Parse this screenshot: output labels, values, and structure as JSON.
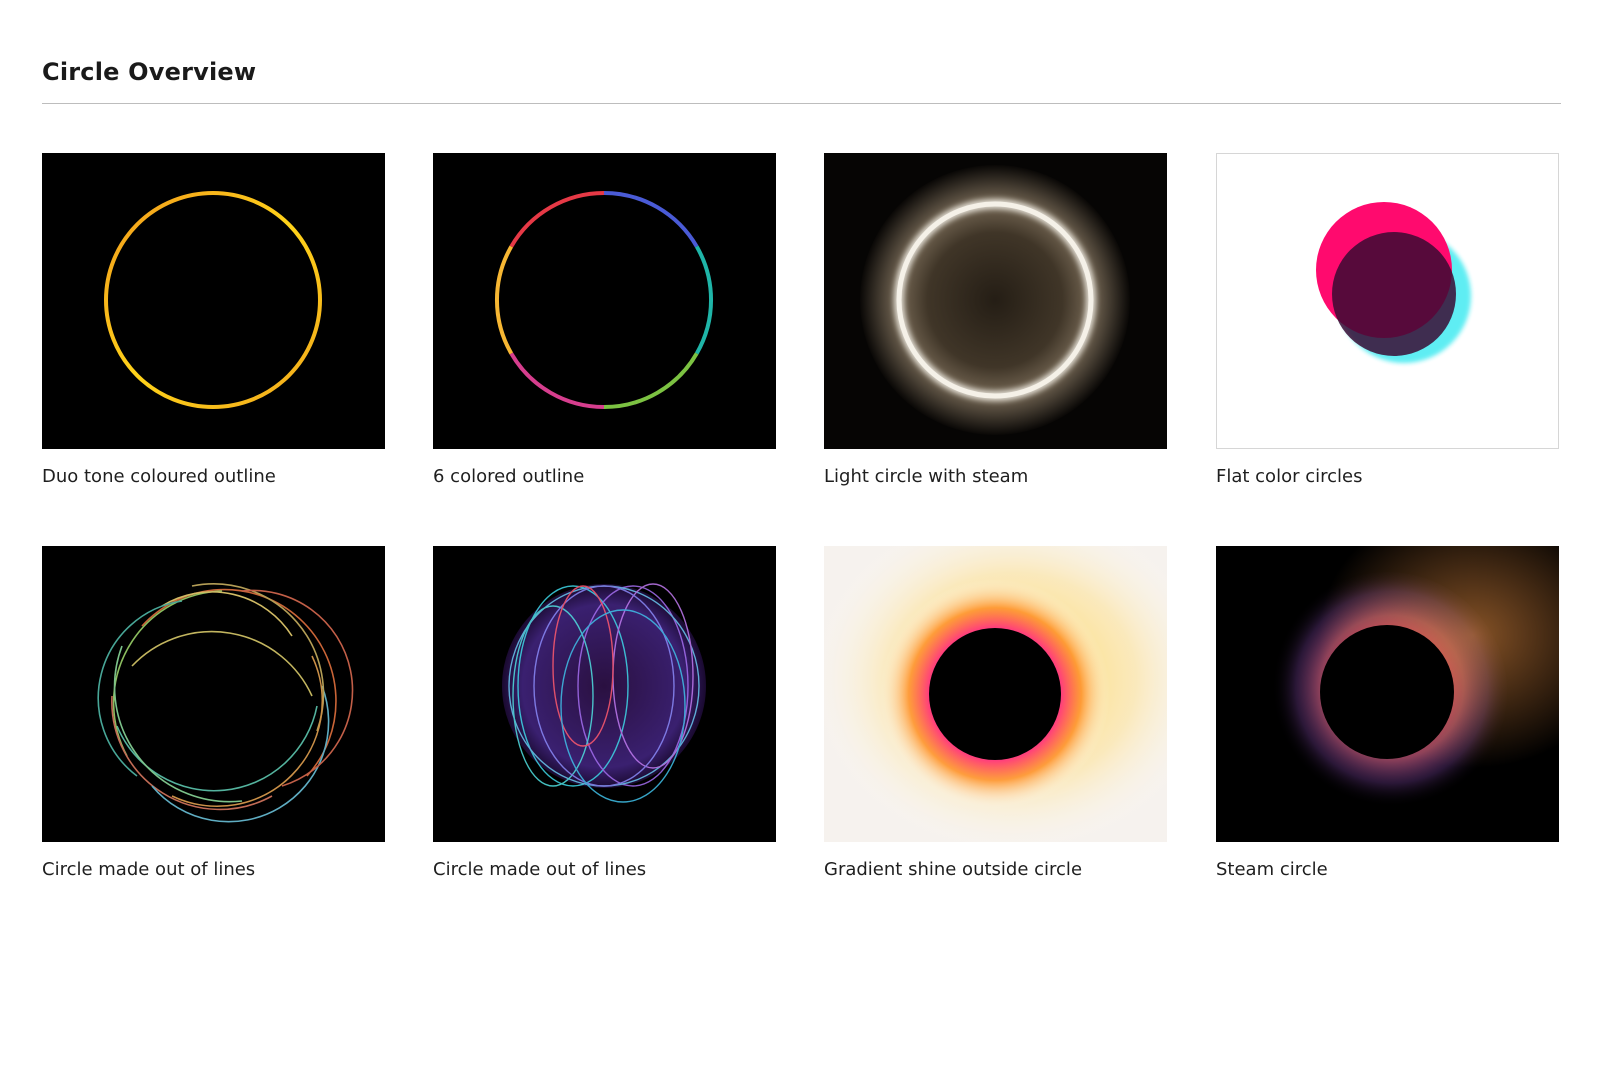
{
  "page": {
    "title": "Circle Overview"
  },
  "tiles": [
    {
      "caption": "Duo tone coloured outline",
      "icon": "duo-tone-ring-icon",
      "colors": [
        "#ffd31a",
        "#f29a1c"
      ]
    },
    {
      "caption": "6 colored outline",
      "icon": "rainbow-ring-icon",
      "colors": [
        "#e63946",
        "#f7b733",
        "#7cc242",
        "#1fb5a8",
        "#4a5bd6",
        "#d63e8e"
      ]
    },
    {
      "caption": "Light circle with steam",
      "icon": "steam-ring-icon",
      "colors": [
        "#f5f1e8",
        "#6b5a44"
      ]
    },
    {
      "caption": "Flat color circles",
      "icon": "overlapping-circles-icon",
      "colors": [
        "#ff0a6e",
        "#1ee6ee",
        "#3a0a32"
      ]
    },
    {
      "caption": "Circle made out of lines",
      "icon": "line-sketch-circle-icon",
      "colors": [
        "#d8c96a",
        "#5ec7b0",
        "#e0703e"
      ]
    },
    {
      "caption": "Circle made out of lines",
      "icon": "neon-line-sphere-icon",
      "colors": [
        "#3fd8e8",
        "#a46ef0",
        "#ff5a6e"
      ]
    },
    {
      "caption": "Gradient shine outside circle",
      "icon": "gradient-eclipse-icon",
      "colors": [
        "#ff2d8a",
        "#ff8a1e",
        "#ffd23a"
      ]
    },
    {
      "caption": "Steam circle",
      "icon": "steam-eclipse-icon",
      "colors": [
        "#d8325e",
        "#e08a40",
        "#6a3a8a"
      ]
    }
  ]
}
